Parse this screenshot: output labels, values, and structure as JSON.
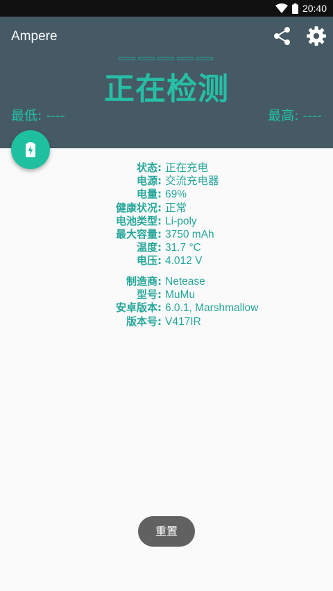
{
  "status_bar": {
    "time": "20:40"
  },
  "app": {
    "title": "Ampere"
  },
  "header": {
    "status_text": "正在检测",
    "min_label": "最低: ----",
    "max_label": "最高: ----",
    "accent_color": "#26a69a",
    "background_color": "#455a64"
  },
  "battery_info": [
    {
      "label": "状态:",
      "value": "正在充电"
    },
    {
      "label": "电源:",
      "value": "交流充电器"
    },
    {
      "label": "电量:",
      "value": "69%"
    },
    {
      "label": "健康状况:",
      "value": "正常"
    },
    {
      "label": "电池类型:",
      "value": "Li-poly"
    },
    {
      "label": "最大容量:",
      "value": "3750 mAh"
    },
    {
      "label": "温度:",
      "value": "31.7 °C"
    },
    {
      "label": "电压:",
      "value": "4.012 V"
    }
  ],
  "device_info": [
    {
      "label": "制造商:",
      "value": "Netease"
    },
    {
      "label": "型号:",
      "value": "MuMu"
    },
    {
      "label": "安卓版本:",
      "value": "6.0.1, Marshmallow"
    },
    {
      "label": "版本号:",
      "value": "V417IR"
    }
  ],
  "buttons": {
    "reset_label": "重置"
  },
  "icons": {
    "share": "share-icon",
    "settings": "gear-icon",
    "fab": "battery-charging-icon"
  }
}
